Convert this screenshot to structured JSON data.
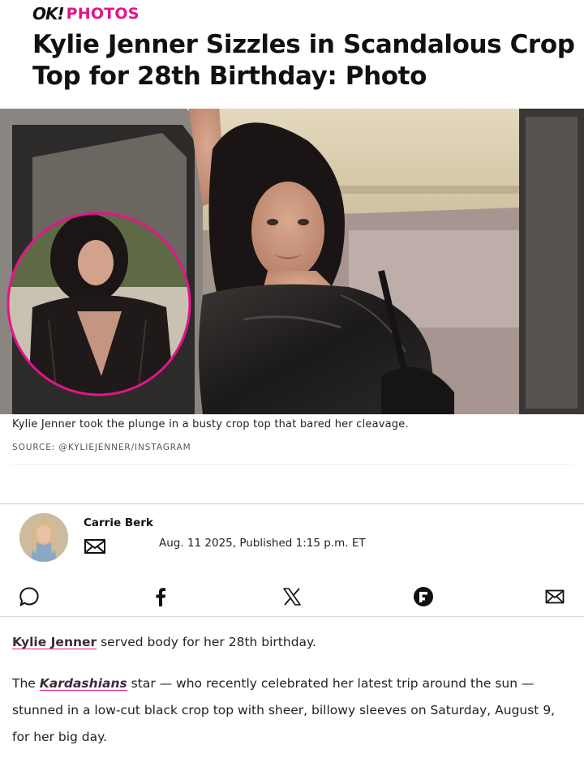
{
  "brand": {
    "logo": "OK!",
    "section": "PHOTOS"
  },
  "article": {
    "headline": "Kylie Jenner Sizzles in Scandalous Crop Top for 28th Birthday: Photo",
    "hero_caption": "Kylie Jenner took the plunge in a busty crop top that bared her cleavage.",
    "hero_source": "SOURCE: @KYLIEJENNER/INSTAGRAM"
  },
  "author": {
    "name": "Carrie Berk",
    "date": "Aug. 11 2025, Published 1:15 p.m. ET"
  },
  "share": [
    {
      "name": "comment-icon"
    },
    {
      "name": "facebook-icon"
    },
    {
      "name": "x-icon"
    },
    {
      "name": "flipboard-icon"
    },
    {
      "name": "email-icon"
    }
  ],
  "body": {
    "p1_link": "Kylie Jenner",
    "p1_text": " served body for her 28th birthday.",
    "p2_start": "The ",
    "p2_link": "Kardashians",
    "p2_text": " star — who recently celebrated her latest trip around the sun — stunned in a low-cut black crop top with sheer, billowy sleeves on Saturday, August 9, for her big day."
  },
  "colors": {
    "accent": "#e6138a",
    "text": "#111111",
    "link": "#3a2b3a"
  }
}
